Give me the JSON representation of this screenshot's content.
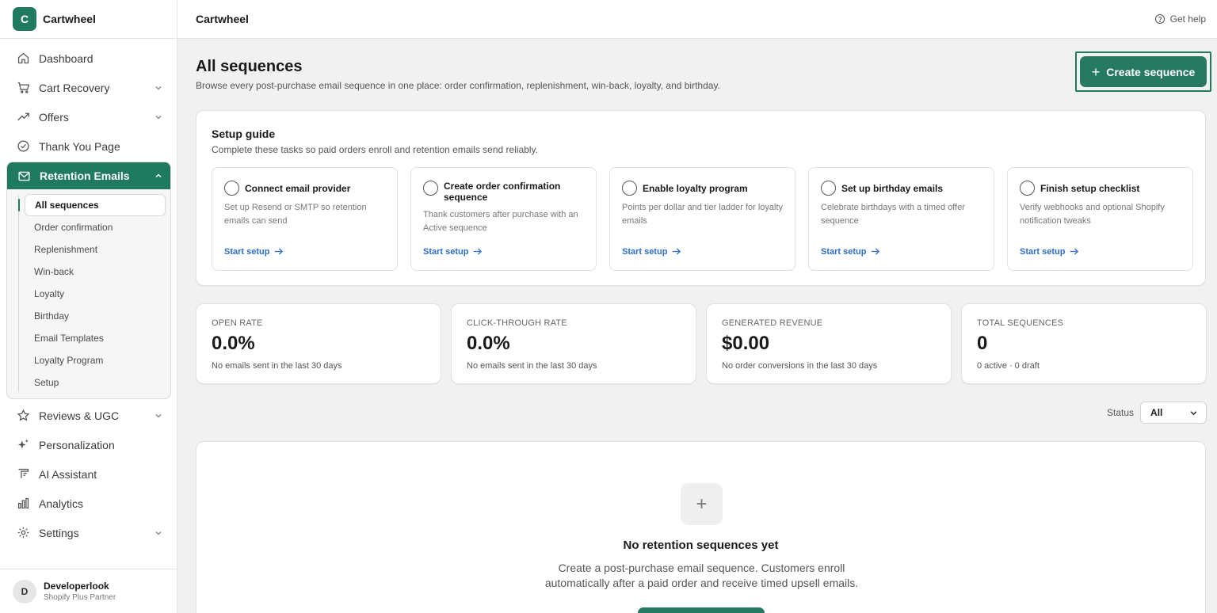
{
  "brand": {
    "initial": "C",
    "name": "Cartwheel"
  },
  "nav": {
    "dashboard": "Dashboard",
    "cart_recovery": "Cart Recovery",
    "offers": "Offers",
    "thank_you": "Thank You Page",
    "retention": "Retention Emails",
    "retention_items": [
      "All sequences",
      "Order confirmation",
      "Replenishment",
      "Win-back",
      "Loyalty",
      "Birthday",
      "Email Templates",
      "Loyalty Program",
      "Setup"
    ],
    "reviews": "Reviews & UGC",
    "personalization": "Personalization",
    "ai_assistant": "AI Assistant",
    "analytics": "Analytics",
    "settings": "Settings"
  },
  "user": {
    "initial": "D",
    "name": "Developerlook",
    "role": "Shopify Plus Partner"
  },
  "topbar": {
    "title": "Cartwheel",
    "help": "Get help"
  },
  "page": {
    "title": "All sequences",
    "subtitle": "Browse every post-purchase email sequence in one place: order confirmation, replenishment, win-back, loyalty, and birthday.",
    "create_label": "Create sequence"
  },
  "setup": {
    "title": "Setup guide",
    "subtitle": "Complete these tasks so paid orders enroll and retention emails send reliably.",
    "tasks": [
      {
        "title": "Connect email provider",
        "desc": "Set up Resend or SMTP so retention emails can send",
        "link": "Start setup"
      },
      {
        "title": "Create order confirmation sequence",
        "desc": "Thank customers after purchase with an Active sequence",
        "link": "Start setup"
      },
      {
        "title": "Enable loyalty program",
        "desc": "Points per dollar and tier ladder for loyalty emails",
        "link": "Start setup"
      },
      {
        "title": "Set up birthday emails",
        "desc": "Celebrate birthdays with a timed offer sequence",
        "link": "Start setup"
      },
      {
        "title": "Finish setup checklist",
        "desc": "Verify webhooks and optional Shopify notification tweaks",
        "link": "Start setup"
      }
    ]
  },
  "stats": [
    {
      "label": "OPEN RATE",
      "value": "0.0%",
      "note": "No emails sent in the last 30 days"
    },
    {
      "label": "CLICK-THROUGH RATE",
      "value": "0.0%",
      "note": "No emails sent in the last 30 days"
    },
    {
      "label": "GENERATED REVENUE",
      "value": "$0.00",
      "note": "No order conversions in the last 30 days"
    },
    {
      "label": "TOTAL SEQUENCES",
      "value": "0",
      "note": "0 active · 0 draft"
    }
  ],
  "filter": {
    "label": "Status",
    "value": "All"
  },
  "empty": {
    "title": "No retention sequences yet",
    "text": "Create a post-purchase email sequence. Customers enroll automatically after a paid order and receive timed upsell emails."
  },
  "colors": {
    "accent": "#1f7a60",
    "link": "#2c6ecb"
  }
}
